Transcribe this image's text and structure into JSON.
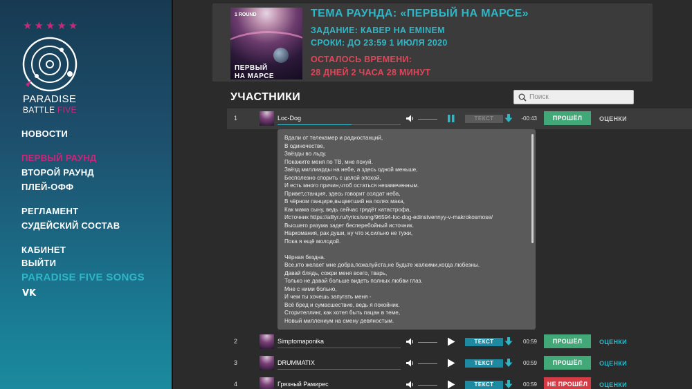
{
  "sidebar": {
    "stars": [
      "★",
      "★",
      "★",
      "★",
      "★"
    ],
    "brand_line1": "PARADISE",
    "brand_line2_a": "BATTLE",
    "brand_line2_b": "FIVE",
    "nav": {
      "news": "НОВОСТИ",
      "round1": "ПЕРВЫЙ РАУНД",
      "round2": "ВТОРОЙ РАУНД",
      "playoff": "ПЛЕЙ-ОФФ",
      "rules": "РЕГЛАМЕНТ",
      "judges": "СУДЕЙСКИЙ СОСТАВ",
      "cabinet": "КАБИНЕТ",
      "logout": "ВЫЙТИ",
      "songs": "PARADISE FIVE SONGS",
      "vk": "VK"
    },
    "active_color": "#c9277a",
    "accent_color": "#2fb7c7"
  },
  "header": {
    "cover_round": "1 ROUND",
    "cover_title_1": "ПЕРВЫЙ",
    "cover_title_2": "НА МАРСЕ",
    "theme": "ТЕМА РАУНДА:  «ПЕРВЫЙ НА МАРСЕ»",
    "task": "ЗАДАНИЕ: КАВЕР НА EMINEM",
    "deadline": "СРОКИ: ДО 23:59 1 ИЮЛЯ 2020",
    "time_left_label": "ОСТАЛОСЬ ВРЕМЕНИ:",
    "time_left_value": "28 ДНЕЙ 2 ЧАСА 28 МИНУТ"
  },
  "participants": {
    "title": "УЧАСТНИКИ",
    "search_placeholder": "Поиск",
    "text_label": "ТЕКСТ",
    "scores_label": "ОЦЕНКИ",
    "rows": [
      {
        "num": "1",
        "name": "Loc-Dog",
        "duration": "-00:43",
        "status": "ПРОШЁЛ",
        "status_type": "pass",
        "playing": true,
        "progress": 0.6
      },
      {
        "num": "2",
        "name": "Simptomaponika",
        "duration": "00:59",
        "status": "ПРОШЁЛ",
        "status_type": "pass",
        "playing": false,
        "progress": 0
      },
      {
        "num": "3",
        "name": "DRUMMATIX",
        "duration": "00:59",
        "status": "ПРОШЁЛ",
        "status_type": "pass",
        "playing": false,
        "progress": 0
      },
      {
        "num": "4",
        "name": "Грязный Рамирес",
        "duration": "00:59",
        "status": "НЕ ПРОШЁЛ",
        "status_type": "fail",
        "playing": false,
        "progress": 0
      }
    ]
  },
  "lyrics": {
    "text": "Вдали от телекамер и радиостанций,\nВ одиночестве,\nЗвёзды во льду.\nПокажите меня по ТВ, мне похуй.\nЗвёзд миллиарды на небе, а здесь одной меньше,\nБесполезно спорить с целой эпохой,\nИ есть много причин,чтоб остаться незамеченным.\nПривет,станция, здесь говорит солдат неба,\nВ чёрном панцире,выцветший на полях мака,\nКак мама сыну, ведь сейчас грядёт катастрофа,\nИсточник https://alllyr.ru/lyrics/song/96594-loc-dog-edinstvennyy-v-makrokosmose/\nВысшего разума задет бесперебойный источник.\nНаркомания, рак души, ну что ж,сильно не тужи,\nПока я ещё молодой.\n\nЧёрная бездна.\nВсе,кто желает мне добра,пожалуйста,не будьте жалкими,когда любезны.\nДавай блядь, сожри меня всего, тварь,\nТолько не давай больше видеть полных любви глаз.\nМне с ними больно,\nИ чем ты хочешь запугать меня -\nВсё бред и сумасшествие, ведь я покойник.\nСторителлинг, как хотел быть пацан в теме,\nНовый миллениум на смену девяностым."
  }
}
